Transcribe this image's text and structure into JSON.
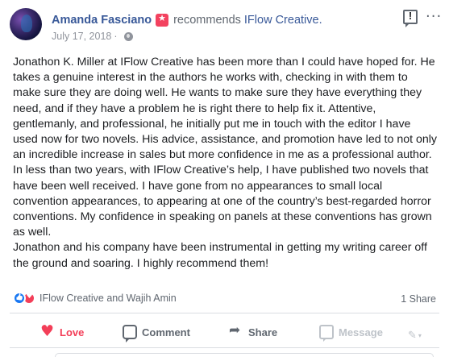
{
  "post": {
    "author": "Amanda Fasciano",
    "action_verb": "recommends",
    "page_name": "IFlow Creative.",
    "date": "July 17, 2018",
    "separator": "·",
    "visibility_icon": "globe-icon",
    "paragraphs": [
      "Jonathon K. Miller at IFlow Creative has been more than I could have hoped for. He takes a genuine interest in the authors he works with, checking in with them to make sure they are doing well. He wants to make sure they have everything they need, and if they have a problem he is right there to help fix it. Attentive, gentlemanly, and professional, he initially put me in touch with the editor I have used now for two novels. His advice, assistance, and promotion have led to not only an incredible increase in sales but more confidence in me as a professional author.",
      "In less than two years, with IFlow Creative’s help, I have published two novels that have been well received. I have gone from no appearances to small local convention appearances, to appearing at one of the country’s best-regarded horror conventions. My confidence in speaking on panels at these conventions has grown as well.",
      "Jonathon and his company have been instrumental in getting my writing career off the ground and soaring. I highly recommend them!"
    ]
  },
  "reactions": {
    "icons": [
      "like-icon",
      "love-icon"
    ],
    "names": "IFlow Creative and Wajih Amin",
    "share_count": "1 Share"
  },
  "actions": {
    "love": "Love",
    "comment": "Comment",
    "share": "Share",
    "message": "Message",
    "select_glyph": "✎",
    "select_caret": "▾"
  },
  "colors": {
    "link": "#385898",
    "love": "#f33e58",
    "muted": "#606770",
    "disabled": "#bec3c9",
    "divider": "#dadde1"
  }
}
